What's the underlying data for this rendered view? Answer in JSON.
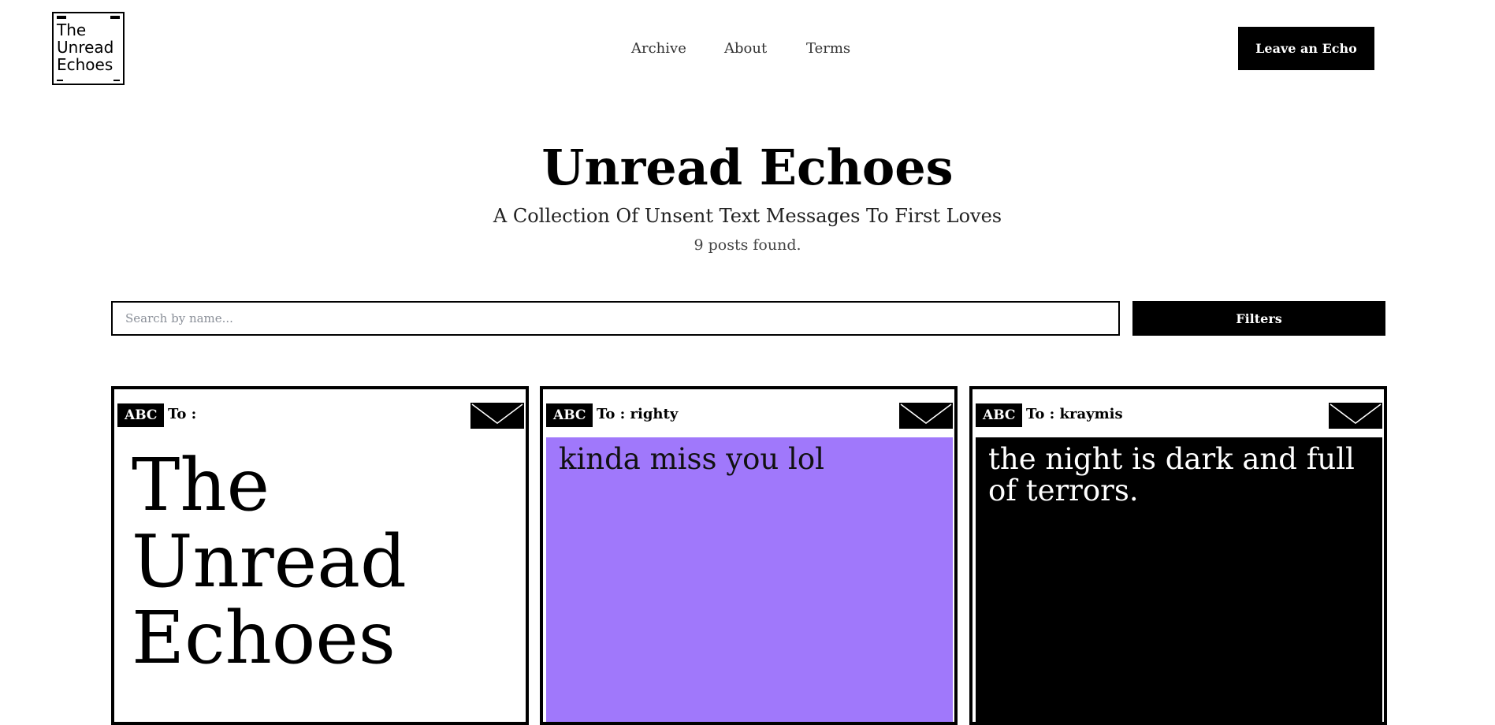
{
  "logo": {
    "text": "The\nUnread\nEchoes"
  },
  "nav": {
    "items": [
      "Archive",
      "About",
      "Terms"
    ]
  },
  "header": {
    "cta_label": "Leave an Echo"
  },
  "hero": {
    "title": "Unread Echoes",
    "subtitle": "A Collection Of Unsent Text Messages To First Loves",
    "count": "9 posts found."
  },
  "search": {
    "placeholder": "Search by name...",
    "value": ""
  },
  "filters": {
    "label": "Filters"
  },
  "cards": [
    {
      "badge": "ABC",
      "to": "To :",
      "message": "The Unread Echoes",
      "bg_color": "#ffffff",
      "text_color": "#000000"
    },
    {
      "badge": "ABC",
      "to": "To : righty",
      "message": "kinda miss you lol",
      "bg_color": "#a078fb",
      "text_color": "#111111"
    },
    {
      "badge": "ABC",
      "to": "To : kraymis",
      "message": "the night is dark and full of terrors.",
      "bg_color": "#000000",
      "text_color": "#ffffff"
    }
  ]
}
